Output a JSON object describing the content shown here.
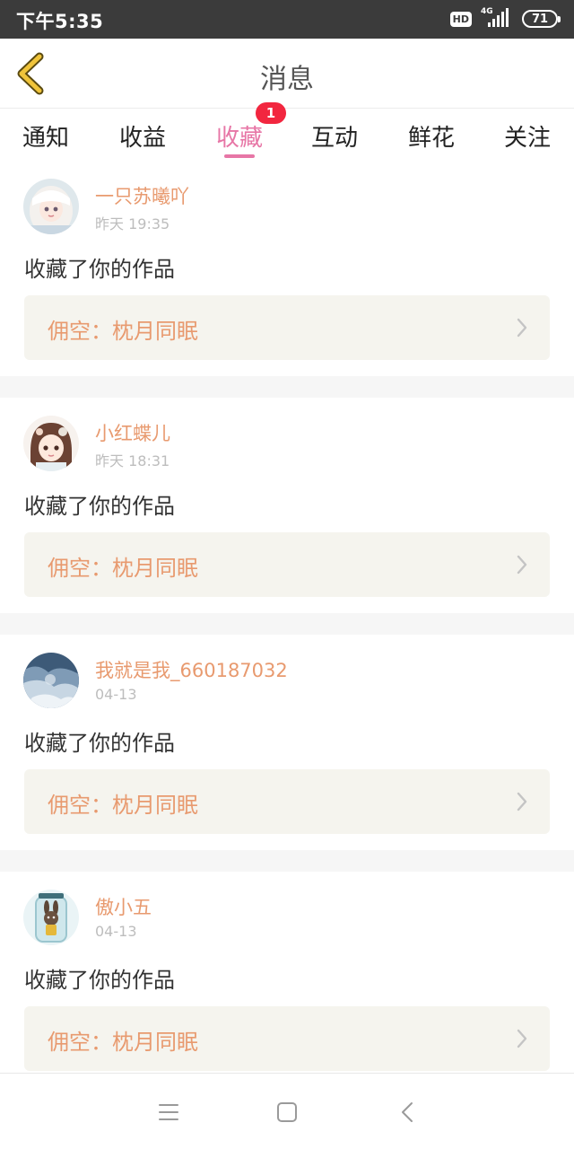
{
  "status_bar": {
    "time": "下午5:35",
    "hd_label": "HD",
    "network_label": "4G",
    "battery": "71"
  },
  "header": {
    "title": "消息",
    "back_icon": "chevron-left-icon",
    "back_icon_color": "#f0c43a"
  },
  "tabs": [
    {
      "label": "通知"
    },
    {
      "label": "收益"
    },
    {
      "label": "收藏",
      "active": true,
      "badge": "1"
    },
    {
      "label": "互动"
    },
    {
      "label": "鲜花"
    },
    {
      "label": "关注"
    }
  ],
  "colors": {
    "accent": "#e776a6",
    "badge": "#f2263f",
    "username": "#e89a6f",
    "card_bg": "#f5f4ee"
  },
  "messages": [
    {
      "user": "一只苏曦吖",
      "time": "昨天 19:35",
      "text": "收藏了你的作品",
      "work": "佣空：枕月同眠",
      "avatar": "avatar-anime-girl-white-hair"
    },
    {
      "user": "小红蝶儿",
      "time": "昨天 18:31",
      "text": "收藏了你的作品",
      "work": "佣空：枕月同眠",
      "avatar": "avatar-anime-girl-brown-hair"
    },
    {
      "user": "我就是我_660187032",
      "time": "04-13",
      "text": "收藏了你的作品",
      "work": "佣空：枕月同眠",
      "avatar": "avatar-frosty-landscape"
    },
    {
      "user": "傲小五",
      "time": "04-13",
      "text": "收藏了你的作品",
      "work": "佣空：枕月同眠",
      "avatar": "avatar-bunny-in-jar"
    }
  ],
  "nav": {
    "menu_icon": "menu-icon",
    "home_icon": "square-home-icon",
    "back_icon": "chevron-left-icon"
  }
}
